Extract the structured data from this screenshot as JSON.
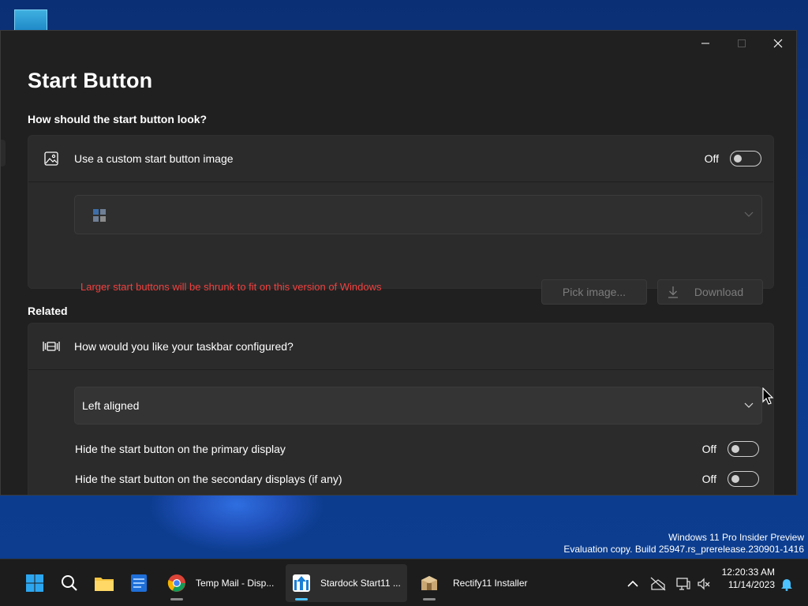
{
  "window": {
    "title": "Start Button",
    "caption": {
      "minimize": "—",
      "maximize": "☐",
      "close": "✕"
    }
  },
  "appearance": {
    "section_label": "How should the start button look?",
    "custom_image": {
      "label": "Use a custom start button image",
      "state": "Off"
    },
    "warning": "Larger start buttons will be shrunk to fit on this version of Windows",
    "pick_button": "Pick image...",
    "download_button": "Download"
  },
  "related": {
    "section_label": "Related",
    "taskbar_question": "How would you like your taskbar configured?",
    "alignment_value": "Left aligned",
    "hide_primary": {
      "label": "Hide the start button on the primary display",
      "state": "Off"
    },
    "hide_secondary": {
      "label": "Hide the start button on the secondary displays (if any)",
      "state": "Off"
    }
  },
  "watermark": {
    "line1": "Windows 11 Pro Insider Preview",
    "line2": "Evaluation copy. Build 25947.rs_prerelease.230901-1416"
  },
  "taskbar": {
    "apps": [
      {
        "name": "start-icon"
      },
      {
        "name": "search-icon"
      },
      {
        "name": "file-explorer-icon"
      },
      {
        "name": "notepad-icon"
      },
      {
        "name": "chrome-icon",
        "label": "Temp Mail - Disp..."
      },
      {
        "name": "start11-icon",
        "label": "Stardock Start11 ..."
      },
      {
        "name": "installer-icon",
        "label": "Rectify11 Installer"
      }
    ],
    "tray": {
      "chevron": "^",
      "time": "12:20:33 AM",
      "date": "11/14/2023"
    }
  },
  "colors": {
    "window_bg": "#202020",
    "card_bg": "#2b2b2b",
    "warning_red": "#f0413f",
    "accent_blue": "#4cc2ff",
    "taskbar_bg": "#1c1c1c"
  }
}
